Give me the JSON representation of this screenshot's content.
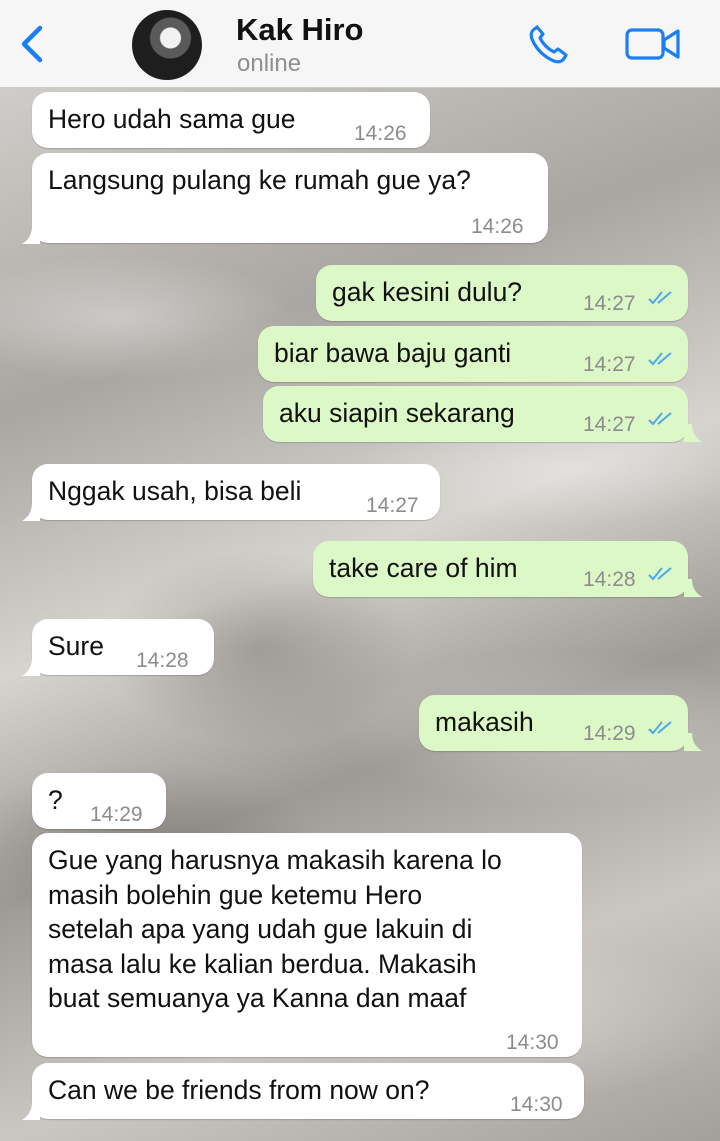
{
  "header": {
    "back_icon": "chevron-left-icon",
    "contact_name": "Kak Hiro",
    "status": "online",
    "call_icon": "phone-icon",
    "video_icon": "video-camera-icon",
    "accent_color": "#1a7ff3"
  },
  "messages": [
    {
      "direction": "incoming",
      "text": "Hero udah sama gue",
      "time": "14:26"
    },
    {
      "direction": "incoming",
      "text": "Langsung pulang ke rumah gue ya?",
      "time": "14:26"
    },
    {
      "direction": "outgoing",
      "text": "gak kesini dulu?",
      "time": "14:27",
      "status": "read"
    },
    {
      "direction": "outgoing",
      "text": "biar bawa baju ganti",
      "time": "14:27",
      "status": "read"
    },
    {
      "direction": "outgoing",
      "text": "aku siapin sekarang",
      "time": "14:27",
      "status": "read"
    },
    {
      "direction": "incoming",
      "text": "Nggak usah, bisa beli",
      "time": "14:27"
    },
    {
      "direction": "outgoing",
      "text": "take care of him",
      "time": "14:28",
      "status": "read"
    },
    {
      "direction": "incoming",
      "text": "Sure",
      "time": "14:28"
    },
    {
      "direction": "outgoing",
      "text": "makasih",
      "time": "14:29",
      "status": "read"
    },
    {
      "direction": "incoming",
      "text": "?",
      "time": "14:29"
    },
    {
      "direction": "incoming",
      "lines": [
        "Gue yang harusnya makasih karena lo",
        "masih bolehin gue ketemu Hero",
        "setelah apa yang udah gue lakuin di",
        "masa lalu ke kalian berdua. Makasih",
        "buat semuanya ya Kanna dan maaf"
      ],
      "time": "14:30"
    },
    {
      "direction": "incoming",
      "text": "Can we be friends from now on?",
      "time": "14:30"
    }
  ],
  "colors": {
    "incoming_bubble": "#ffffff",
    "outgoing_bubble": "#dcf8c6",
    "read_ticks": "#4fa8e8"
  }
}
